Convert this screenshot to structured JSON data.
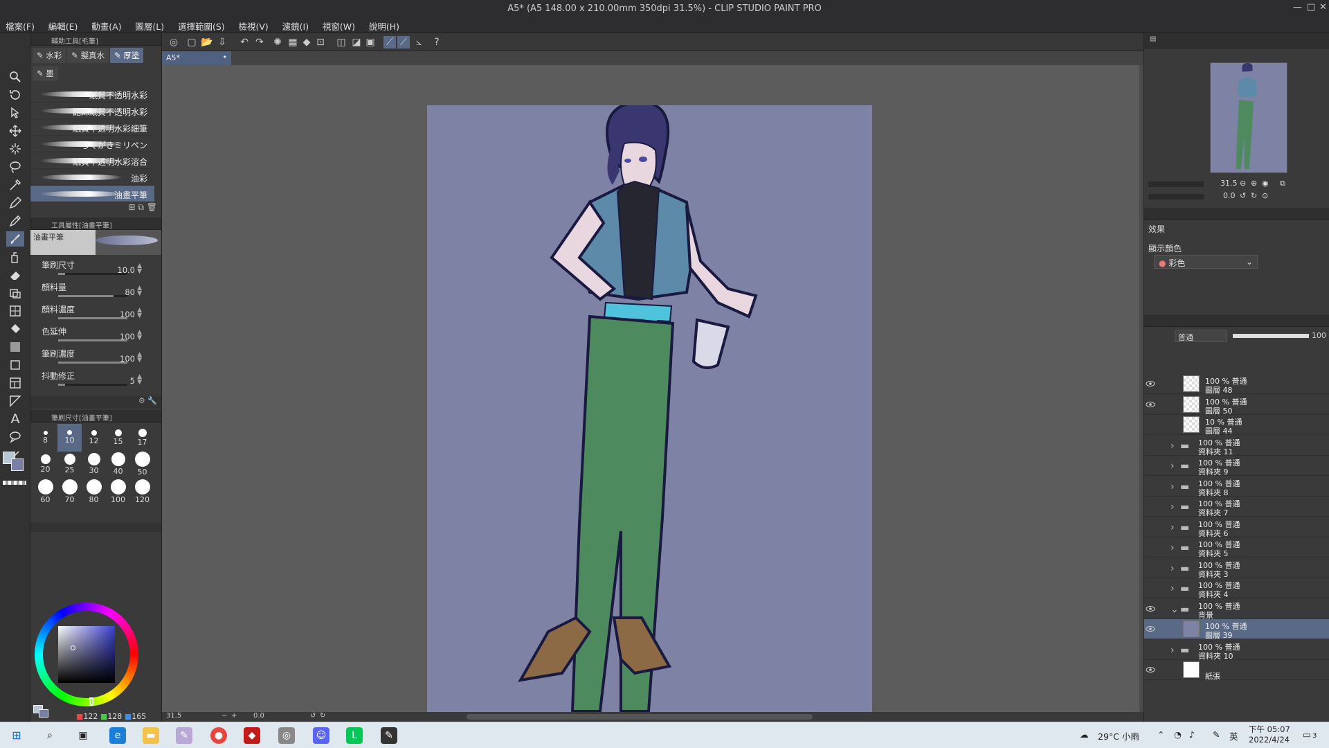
{
  "window": {
    "title": "A5* (A5 148.00 x 210.00mm 350dpi 31.5%)  - CLIP STUDIO PAINT PRO",
    "min": "—",
    "max": "□",
    "close": "✕"
  },
  "menu": [
    "檔案(F)",
    "編輯(E)",
    "動畫(A)",
    "圖層(L)",
    "選擇範圍(S)",
    "檢視(V)",
    "濾鏡(I)",
    "視窗(W)",
    "說明(H)"
  ],
  "tool_panel": {
    "header": "輔助工具[毛筆]",
    "subtabs": [
      {
        "label": "水彩"
      },
      {
        "label": "擬真水"
      },
      {
        "label": "厚塗"
      },
      {
        "label": "墨"
      }
    ],
    "brushes": [
      "紙質不透明水彩",
      "飽綿紙質不透明水彩",
      "紙質不透明水彩細筆",
      "らくがきミリペン",
      "紙質不透明水彩溶合",
      "油彩",
      "油畫平筆"
    ],
    "props_header": "工具屬性[油畫平筆]",
    "preview_name": "油畫平筆",
    "props": [
      {
        "label": "筆刷尺寸",
        "value": "10.0",
        "fill": 0.1
      },
      {
        "label": "顏料量",
        "value": "80",
        "fill": 0.8
      },
      {
        "label": "顏料濃度",
        "value": "100",
        "fill": 1.0
      },
      {
        "label": "色延伸",
        "value": "100",
        "fill": 1.0
      },
      {
        "label": "筆刷濃度",
        "value": "100",
        "fill": 1.0
      },
      {
        "label": "抖動修正",
        "value": "5",
        "fill": 0.1
      }
    ],
    "size_header": "筆刷尺寸[油畫平筆]",
    "sizes": [
      "8",
      "10",
      "12",
      "15",
      "17",
      "20",
      "25",
      "30",
      "40",
      "50",
      "60",
      "70",
      "80",
      "100",
      "120"
    ],
    "color_values": {
      "r": "122",
      "g": "128",
      "b": "165"
    }
  },
  "canvas": {
    "tab_label": "A5*",
    "zoom": "31.5",
    "angle": "0.0",
    "page_color": "#7e83a5"
  },
  "navigator": {
    "zoom": "31.5",
    "angle": "0.0"
  },
  "layer_property": {
    "effect_label": "效果",
    "display_color_label": "顯示顏色",
    "color_mode": "彩色"
  },
  "layer_panel": {
    "blend_mode": "普通",
    "opacity": "100",
    "layers": [
      {
        "opacity": "100 % 普通",
        "name": "圖層 48",
        "type": "layer",
        "visible": true,
        "selected": false
      },
      {
        "opacity": "100 % 普通",
        "name": "圖層 50",
        "type": "layer",
        "visible": true,
        "selected": false
      },
      {
        "opacity": "10 % 普通",
        "name": "圖層 44",
        "type": "layer",
        "visible": false,
        "selected": false
      },
      {
        "opacity": "100 % 普通",
        "name": "資料夾 11",
        "type": "folder",
        "visible": false,
        "selected": false
      },
      {
        "opacity": "100 % 普通",
        "name": "資料夾 9",
        "type": "folder",
        "visible": false,
        "selected": false
      },
      {
        "opacity": "100 % 普通",
        "name": "資料夾 8",
        "type": "folder",
        "visible": false,
        "selected": false
      },
      {
        "opacity": "100 % 普通",
        "name": "資料夾 7",
        "type": "folder",
        "visible": false,
        "selected": false
      },
      {
        "opacity": "100 % 普通",
        "name": "資料夾 6",
        "type": "folder",
        "visible": false,
        "selected": false
      },
      {
        "opacity": "100 % 普通",
        "name": "資料夾 5",
        "type": "folder",
        "visible": false,
        "selected": false
      },
      {
        "opacity": "100 % 普通",
        "name": "資料夾 3",
        "type": "folder",
        "visible": false,
        "selected": false
      },
      {
        "opacity": "100 % 普通",
        "name": "資料夾 4",
        "type": "folder",
        "visible": false,
        "selected": false
      },
      {
        "opacity": "100 % 普通",
        "name": "背景",
        "type": "folder-open",
        "visible": true,
        "selected": false
      },
      {
        "opacity": "100 % 普通",
        "name": "圖層 39",
        "type": "layer-color",
        "visible": true,
        "selected": true
      },
      {
        "opacity": "100 % 普通",
        "name": "資料夾 10",
        "type": "folder",
        "visible": false,
        "selected": false
      },
      {
        "opacity": "",
        "name": "紙張",
        "type": "paper",
        "visible": true,
        "selected": false
      }
    ]
  },
  "taskbar": {
    "weather": "29°C  小雨",
    "time": "下午 05:07",
    "date": "2022/4/24",
    "ime": "英",
    "notif_count": "3"
  }
}
